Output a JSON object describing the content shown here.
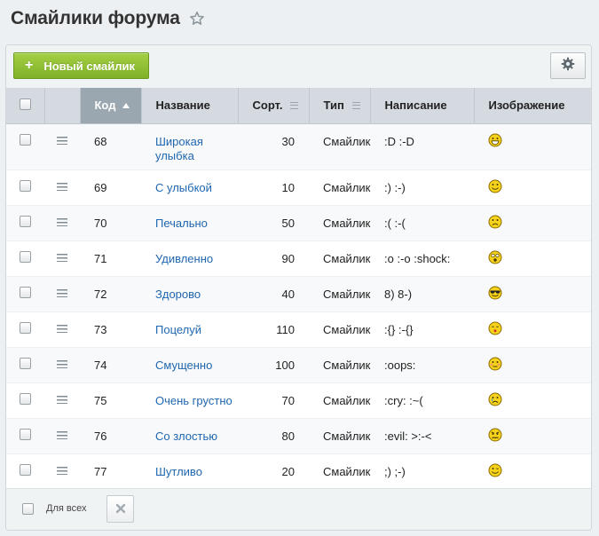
{
  "page": {
    "title": "Смайлики форума"
  },
  "toolbar": {
    "add_label": "Новый смайлик",
    "add_icon": "plus-icon",
    "settings_icon": "gear-icon"
  },
  "table": {
    "headers": {
      "code": "Код",
      "name": "Название",
      "sort": "Сорт.",
      "type": "Тип",
      "typing": "Написание",
      "image": "Изображение"
    },
    "rows": [
      {
        "code": "68",
        "name": "Широкая улыбка",
        "sort": "30",
        "type": "Смайлик",
        "typing": ":D :-D",
        "icon": "big-grin"
      },
      {
        "code": "69",
        "name": "С улыбкой",
        "sort": "10",
        "type": "Смайлик",
        "typing": ":) :-)",
        "icon": "smile"
      },
      {
        "code": "70",
        "name": "Печально",
        "sort": "50",
        "type": "Смайлик",
        "typing": ":( :-(",
        "icon": "sad"
      },
      {
        "code": "71",
        "name": "Удивленно",
        "sort": "90",
        "type": "Смайлик",
        "typing": ":o :-o :shock:",
        "icon": "surprised"
      },
      {
        "code": "72",
        "name": "Здорово",
        "sort": "40",
        "type": "Смайлик",
        "typing": "8) 8-)",
        "icon": "cool"
      },
      {
        "code": "73",
        "name": "Поцелуй",
        "sort": "110",
        "type": "Смайлик",
        "typing": ":{} :-{}",
        "icon": "kiss"
      },
      {
        "code": "74",
        "name": "Смущенно",
        "sort": "100",
        "type": "Смайлик",
        "typing": ":oops:",
        "icon": "embarrassed"
      },
      {
        "code": "75",
        "name": "Очень грустно",
        "sort": "70",
        "type": "Смайлик",
        "typing": ":cry: :~(",
        "icon": "cry"
      },
      {
        "code": "76",
        "name": "Со злостью",
        "sort": "80",
        "type": "Смайлик",
        "typing": ":evil: >:-<",
        "icon": "angry"
      },
      {
        "code": "77",
        "name": "Шутливо",
        "sort": "20",
        "type": "Смайлик",
        "typing": ";) ;-)",
        "icon": "wink"
      }
    ]
  },
  "footer": {
    "select_all_label": "Для всех",
    "delete_icon": "close-icon"
  },
  "colors": {
    "accent_green": "#8bbd2f",
    "link_blue": "#2067b0",
    "header_sorted": "#9aa6b0",
    "smiley_yellow": "#f7d21b"
  }
}
